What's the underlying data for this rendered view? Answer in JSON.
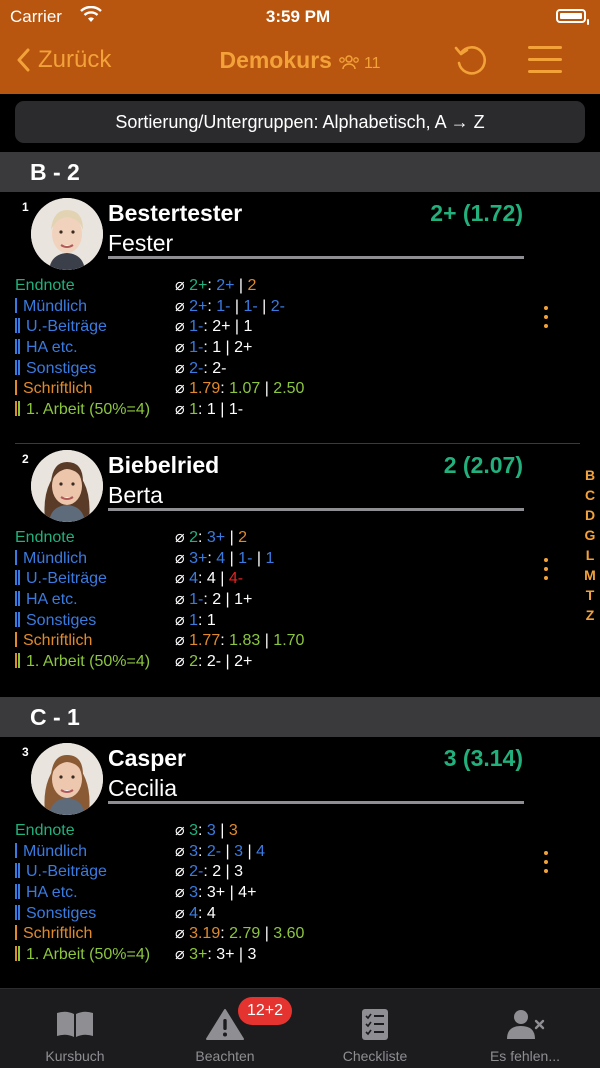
{
  "status_bar": {
    "carrier": "Carrier",
    "time": "3:59 PM"
  },
  "nav": {
    "back_label": "Zurück",
    "title": "Demokurs",
    "count": "11"
  },
  "sort": {
    "label": "Sortierung/Untergruppen: Alphabetisch, A → Z"
  },
  "sections": [
    "B - 2",
    "C - 1"
  ],
  "students": [
    {
      "number": "1",
      "last_name": "Bestertester",
      "first_name": "Fester",
      "grade": "2+ (1.72)",
      "rows": [
        {
          "label": "Endnote",
          "values": [
            "⌀ ",
            "2+",
            ": ",
            "2+",
            " | ",
            "2"
          ]
        },
        {
          "label": "Mündlich",
          "values": [
            "⌀ ",
            "2+",
            ": ",
            "1-",
            " | ",
            "1-",
            " | ",
            "2-"
          ]
        },
        {
          "label": "U.-Beiträge",
          "values": [
            "⌀ ",
            "1-",
            ": ",
            "2+",
            " | ",
            "1"
          ]
        },
        {
          "label": "HA etc.",
          "values": [
            "⌀ ",
            "1-",
            ": ",
            "1",
            " | ",
            "2+"
          ]
        },
        {
          "label": "Sonstiges",
          "values": [
            "⌀ ",
            "2-",
            ": ",
            "2-"
          ]
        },
        {
          "label": "Schriftlich",
          "values": [
            "⌀ ",
            "1.79",
            ": ",
            "1.07",
            " | ",
            "2.50"
          ]
        },
        {
          "label": "1. Arbeit (50%=4)",
          "values": [
            "⌀ ",
            "1",
            ": ",
            "1",
            " | ",
            "1-"
          ]
        }
      ]
    },
    {
      "number": "2",
      "last_name": "Biebelried",
      "first_name": "Berta",
      "grade": "2 (2.07)",
      "rows": [
        {
          "label": "Endnote",
          "values": [
            "⌀ ",
            "2",
            ": ",
            "3+",
            " | ",
            "2"
          ]
        },
        {
          "label": "Mündlich",
          "values": [
            "⌀ ",
            "3+",
            ": ",
            "4",
            " | ",
            "1-",
            " | ",
            "1"
          ]
        },
        {
          "label": "U.-Beiträge",
          "values": [
            "⌀ ",
            "4",
            ": ",
            "4",
            " | ",
            "4-"
          ]
        },
        {
          "label": "HA etc.",
          "values": [
            "⌀ ",
            "1-",
            ": ",
            "2",
            " | ",
            "1+"
          ]
        },
        {
          "label": "Sonstiges",
          "values": [
            "⌀ ",
            "1",
            ": ",
            "1"
          ]
        },
        {
          "label": "Schriftlich",
          "values": [
            "⌀ ",
            "1.77",
            ": ",
            "1.83",
            " | ",
            "1.70"
          ]
        },
        {
          "label": "1. Arbeit (50%=4)",
          "values": [
            "⌀ ",
            "2",
            ": ",
            "2-",
            " | ",
            "2+"
          ]
        }
      ]
    },
    {
      "number": "3",
      "last_name": "Casper",
      "first_name": "Cecilia",
      "grade": "3 (3.14)",
      "rows": [
        {
          "label": "Endnote",
          "values": [
            "⌀ ",
            "3",
            ": ",
            "3",
            " | ",
            "3"
          ]
        },
        {
          "label": "Mündlich",
          "values": [
            "⌀ ",
            "3",
            ": ",
            "2-",
            " | ",
            "3",
            " | ",
            "4"
          ]
        },
        {
          "label": "U.-Beiträge",
          "values": [
            "⌀ ",
            "2-",
            ": ",
            "2",
            " | ",
            "3"
          ]
        },
        {
          "label": "HA etc.",
          "values": [
            "⌀ ",
            "3",
            ": ",
            "3+",
            " | ",
            "4+"
          ]
        },
        {
          "label": "Sonstiges",
          "values": [
            "⌀ ",
            "4",
            ": ",
            "4"
          ]
        },
        {
          "label": "Schriftlich",
          "values": [
            "⌀ ",
            "3.19",
            ": ",
            "2.79",
            " | ",
            "3.60"
          ]
        },
        {
          "label": "1. Arbeit (50%=4)",
          "values": [
            "⌀ ",
            "3+",
            ": ",
            "3+",
            " | ",
            "3"
          ]
        }
      ]
    }
  ],
  "index_letters": [
    "B",
    "C",
    "D",
    "G",
    "L",
    "M",
    "T",
    "Z"
  ],
  "tabs": [
    {
      "label": "Kursbuch",
      "icon": "book-icon"
    },
    {
      "label": "Beachten",
      "icon": "warning-icon"
    },
    {
      "label": "Checkliste",
      "icon": "checklist-icon"
    },
    {
      "label": "Es fehlen...",
      "icon": "person-x-icon"
    }
  ],
  "badge": "12+2",
  "colors": {
    "nav_bg": "#b8550e",
    "accent": "#f3a23a",
    "grade": "#22b07d",
    "oral": "#3a7be0",
    "written": "#e08a2c",
    "exam": "#8cc63f",
    "bad": "#e52222"
  }
}
